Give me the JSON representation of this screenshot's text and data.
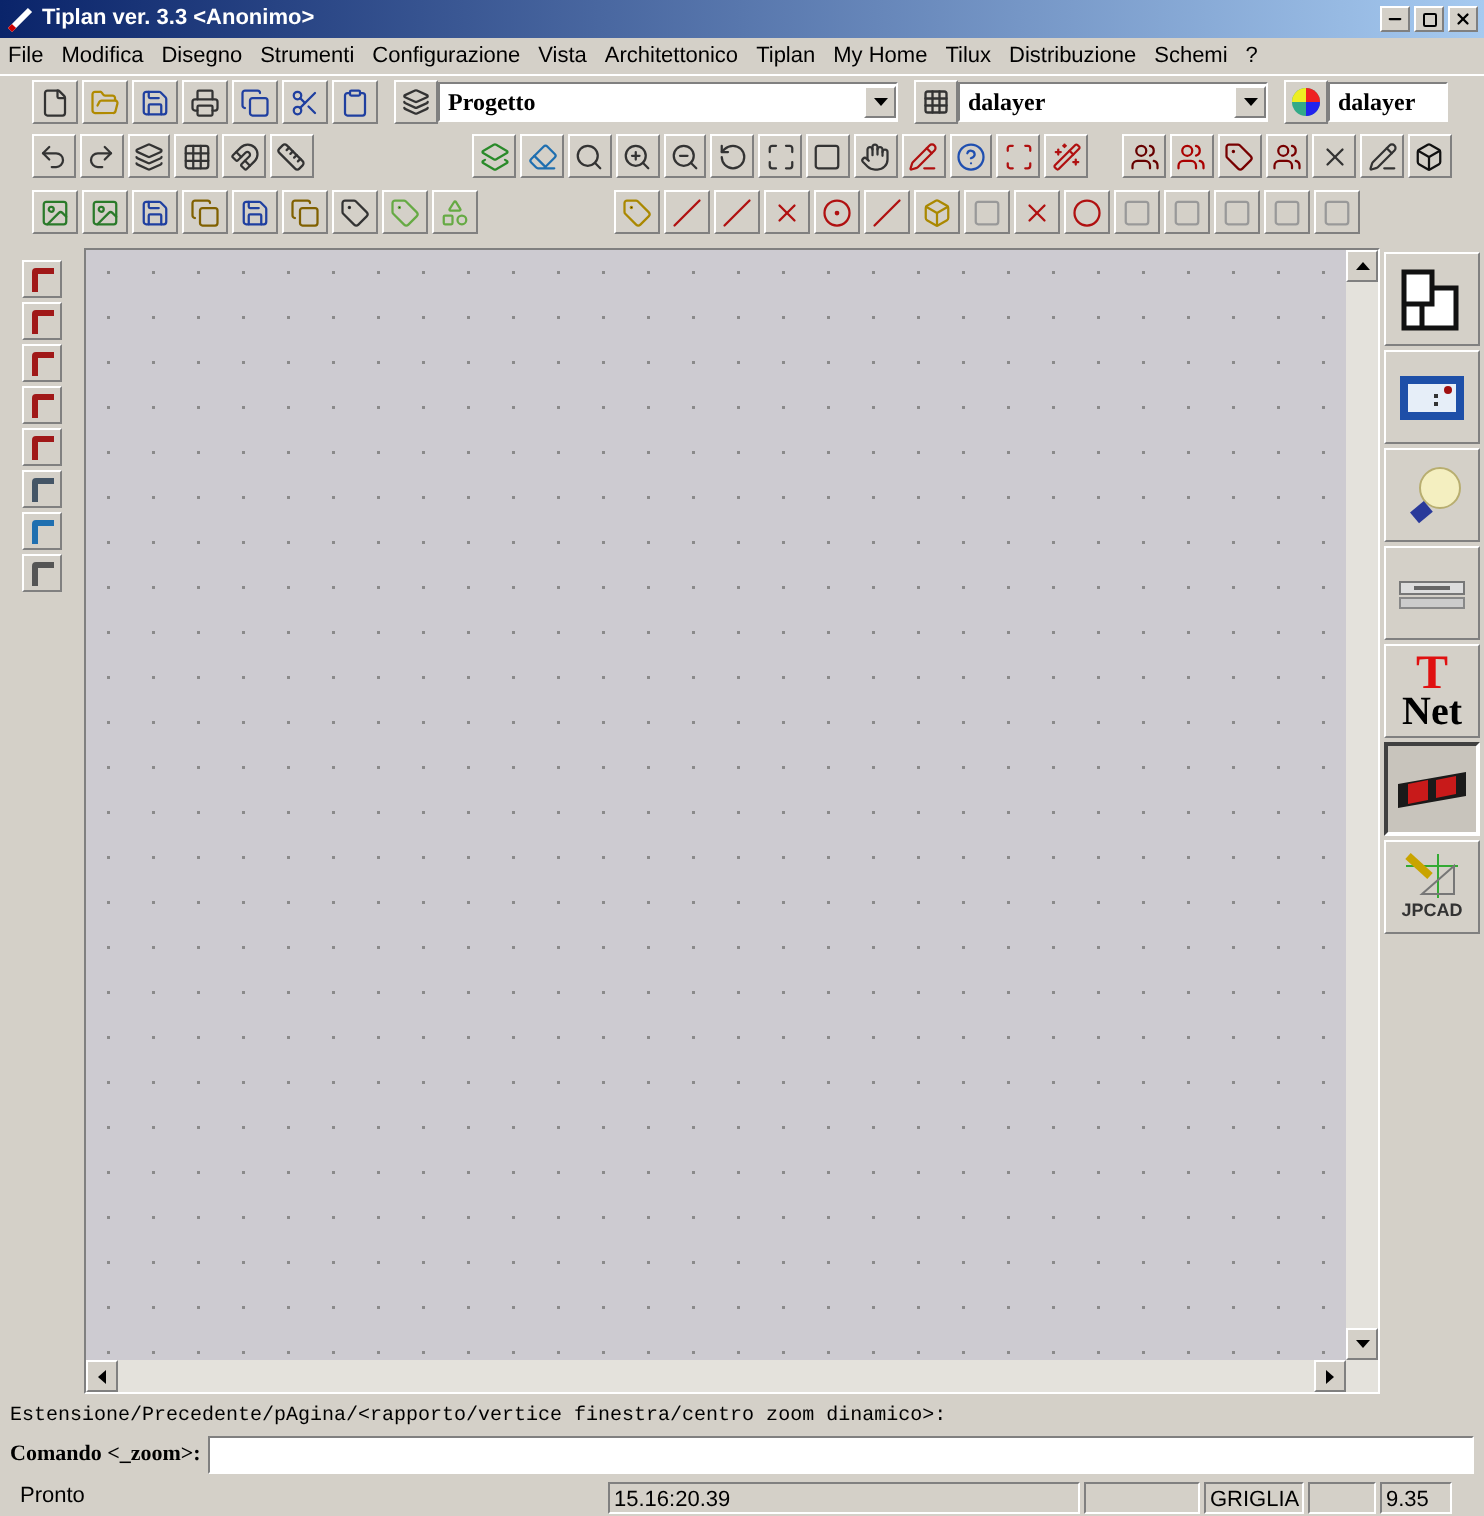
{
  "window": {
    "title": "Tiplan ver. 3.3 <Anonimo>"
  },
  "menu": [
    "File",
    "Modifica",
    "Disegno",
    "Strumenti",
    "Configurazione",
    "Vista",
    "Architettonico",
    "Tiplan",
    "My Home",
    "Tilux",
    "Distribuzione",
    "Schemi",
    "?"
  ],
  "combos": [
    {
      "kind": "layers",
      "value": "Progetto"
    },
    {
      "kind": "linetype",
      "value": "dalayer"
    },
    {
      "kind": "color",
      "value": "dalayer"
    }
  ],
  "palette": [
    {
      "kind": "floorplan",
      "selected": false
    },
    {
      "kind": "panel",
      "selected": false
    },
    {
      "kind": "bulb",
      "selected": false
    },
    {
      "kind": "rack",
      "selected": false
    },
    {
      "kind": "logo",
      "selected": false,
      "lines": [
        "T",
        "Net"
      ]
    },
    {
      "kind": "cable",
      "selected": true
    },
    {
      "kind": "jpcad",
      "selected": false,
      "label": "JPCAD"
    }
  ],
  "command": {
    "prompt": "Estensione/Precedente/pAgina/<rapporto/vertice finestra/centro zoom dinamico>:",
    "label": "Comando <_zoom>:"
  },
  "status_bar": {
    "message": "Pronto",
    "time": "15.16:20.39",
    "mode": "GRIGLIA",
    "value": "9.35"
  }
}
